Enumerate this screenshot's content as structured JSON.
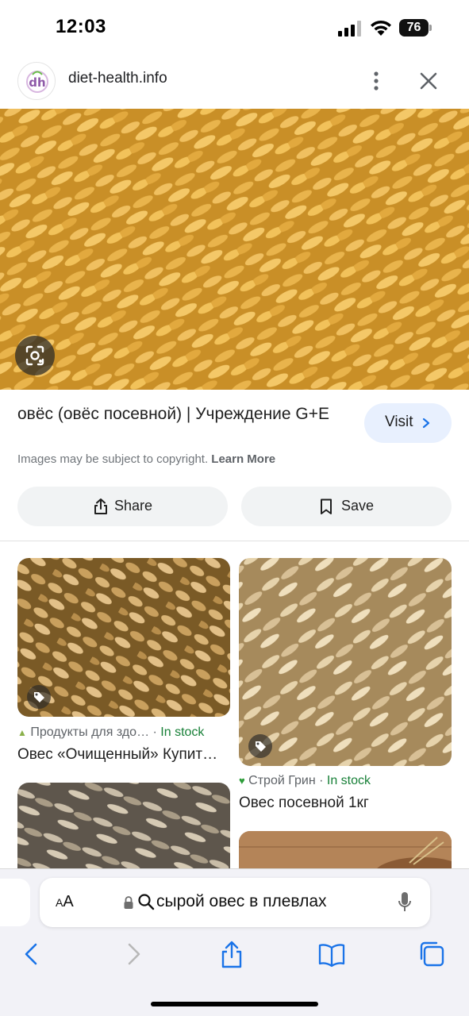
{
  "status_bar": {
    "time": "12:03",
    "battery": "76"
  },
  "site_header": {
    "site_name": "diet-health.info",
    "favicon_text": "dh"
  },
  "result": {
    "title": "овёс (овёс посевной) | Учреждение G+E",
    "visit_label": "Visit",
    "copyright_text": "Images may be subject to copyright.",
    "learn_more": "Learn More",
    "share_label": "Share",
    "save_label": "Save"
  },
  "related": [
    {
      "source": "Продукты для здо…",
      "stock": "In stock",
      "title": "Овес «Очищенный» Купит…"
    },
    {
      "source": "Строй Грин",
      "stock": "In stock",
      "title": "Овес посевной 1кг"
    }
  ],
  "meta_separator": " · ",
  "browser": {
    "aa_small": "A",
    "aa_big": "A",
    "query": "сырой овес в плевлах"
  },
  "colors": {
    "accent_blue": "#1a73e8",
    "in_stock_green": "#188038",
    "visit_bg": "#e8f0fe"
  },
  "icons": [
    "signal-icon",
    "wifi-icon",
    "kebab-menu-icon",
    "close-icon",
    "lens-icon",
    "share-icon",
    "bookmark-icon",
    "tag-icon",
    "lock-icon",
    "search-icon",
    "mic-icon",
    "back-icon",
    "forward-icon",
    "share-sheet-icon",
    "bookmarks-icon",
    "tabs-icon"
  ]
}
